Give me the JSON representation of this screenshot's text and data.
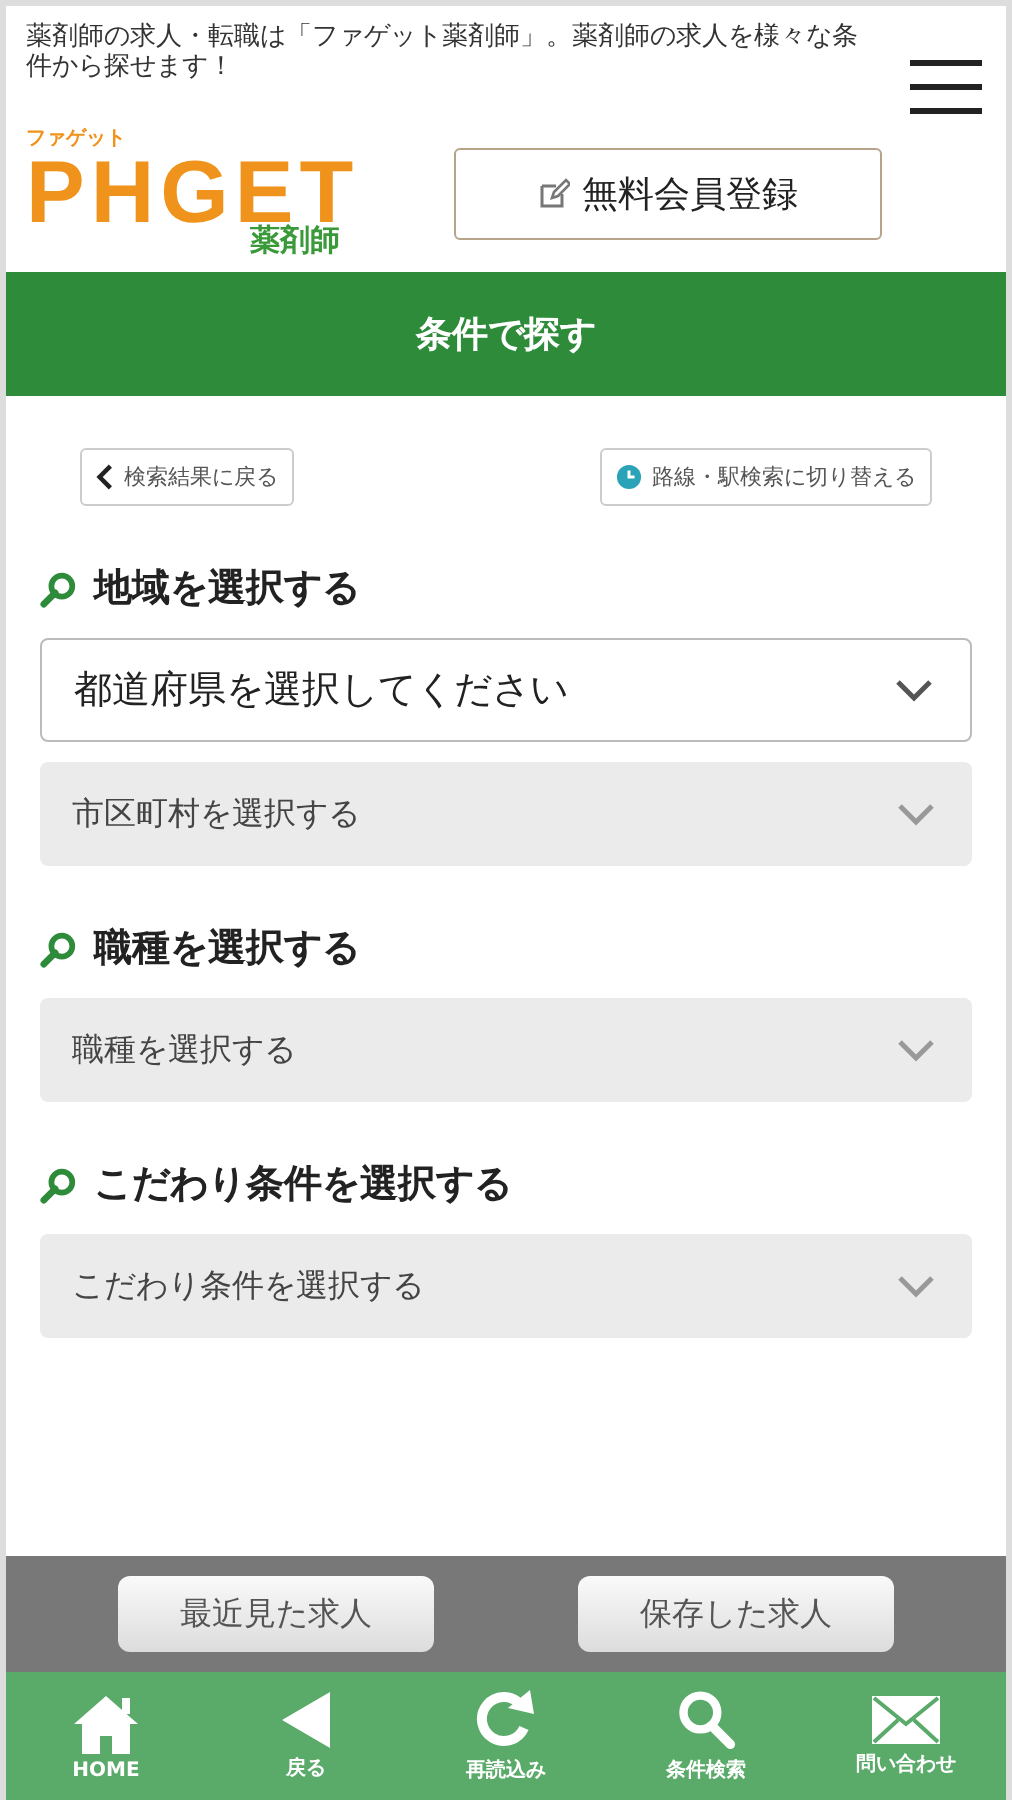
{
  "header": {
    "description": "薬剤師の求人・転職は「ファゲット薬剤師」。薬剤師の求人を様々な条件から探せます！",
    "logo": {
      "tagline": "ファゲット",
      "wordmark": "PHGET",
      "subtitle": "薬剤師"
    },
    "register_button": "無料会員登録"
  },
  "title_bar": "条件で探す",
  "actions": {
    "back": "検索結果に戻る",
    "switch": "路線・駅検索に切り替える"
  },
  "sections": [
    {
      "title": "地域を選択する",
      "selects": [
        {
          "kind": "primary",
          "value": "都道府県を選択してください"
        },
        {
          "kind": "secondary",
          "value": "市区町村を選択する"
        }
      ]
    },
    {
      "title": "職種を選択する",
      "selects": [
        {
          "kind": "secondary",
          "value": "職種を選択する"
        }
      ]
    },
    {
      "title": "こだわり条件を選択する",
      "selects": [
        {
          "kind": "secondary",
          "value": "こだわり条件を選択する"
        }
      ]
    }
  ],
  "saved_bar": [
    "最近見た求人",
    "保存した求人"
  ],
  "bottom_nav": [
    {
      "kind": "home",
      "label": "HOME"
    },
    {
      "kind": "back",
      "label": "戻る"
    },
    {
      "kind": "reload",
      "label": "再読込み"
    },
    {
      "kind": "search",
      "label": "条件検索"
    },
    {
      "kind": "mail",
      "label": "問い合わせ"
    }
  ]
}
